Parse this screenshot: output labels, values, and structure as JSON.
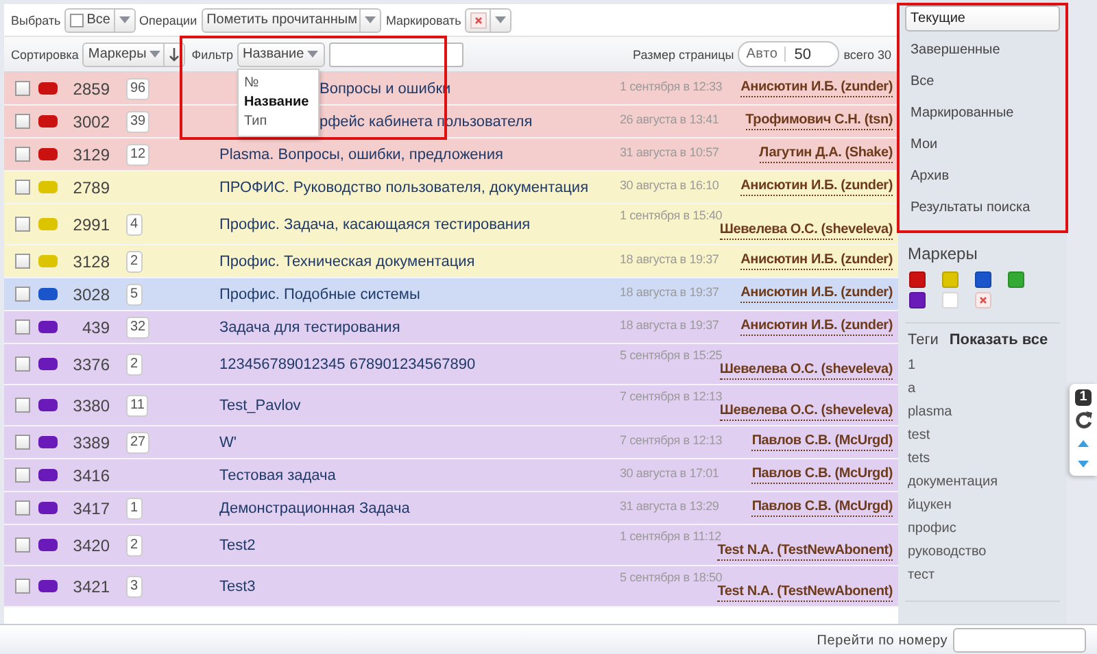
{
  "toolbar": {
    "select_label": "Выбрать",
    "select_all": {
      "label": "Все",
      "checked": false
    },
    "operations_label": "Операции",
    "operations_value": "Пометить прочитанным",
    "mark_label": "Маркировать"
  },
  "sortbar": {
    "sort_label": "Сортировка",
    "sort_value": "Маркеры",
    "filter_label": "Фильтр",
    "filter_field": "Название",
    "filter_options": [
      {
        "label": "№",
        "selected": false
      },
      {
        "label": "Название",
        "selected": true
      },
      {
        "label": "Тип",
        "selected": false
      }
    ],
    "page_size_label": "Размер страницы",
    "page_size_auto": "Авто",
    "page_size_value": "50",
    "total": "всего 30"
  },
  "rows": [
    {
      "checked": false,
      "color": "#cc1111",
      "number": "2859",
      "count": "96",
      "title": "Вопросы и ошибки",
      "date": "1 сентября в 12:33",
      "author": "Анисютин И.Б. (zunder)"
    },
    {
      "checked": false,
      "color": "#cc1111",
      "number": "3002",
      "count": "39",
      "title": "рфейс кабинета пользователя",
      "date": "26 августа в 13:41",
      "author": "Трофимович С.Н. (tsn)"
    },
    {
      "checked": false,
      "color": "#cc1111",
      "number": "3129",
      "count": "12",
      "title": "Plasma. Вопросы, ошибки, предложения",
      "date": "31 августа в 10:57",
      "author": "Лагутин Д.А. (Shake)"
    },
    {
      "checked": false,
      "color": "#ddc400",
      "number": "2789",
      "title": "ПРОФИС. Руководство пользователя, документация",
      "date": "30 августа в 16:10",
      "author": "Анисютин И.Б. (zunder)"
    },
    {
      "checked": false,
      "color": "#ddc400",
      "number": "2991",
      "count": "4",
      "title": "Профис. Задача, касающаяся тестирования",
      "date": "1 сентября в 15:40",
      "author": "Шевелева О.С. (sheveleva)"
    },
    {
      "checked": false,
      "color": "#ddc400",
      "number": "3128",
      "count": "2",
      "title": "Профис. Техническая документация",
      "date": "18 августа в 19:37",
      "author": "Анисютин И.Б. (zunder)"
    },
    {
      "checked": false,
      "color": "#1a55cc",
      "number": "3028",
      "count": "5",
      "title": "Профис. Подобные системы",
      "date": "18 августа в 19:37",
      "author": "Анисютин И.Б. (zunder)"
    },
    {
      "checked": false,
      "color": "#6a1ab8",
      "number": "439",
      "count": "32",
      "title": "Задача для тестирования",
      "date": "18 августа в 19:37",
      "author": "Анисютин И.Б. (zunder)"
    },
    {
      "checked": false,
      "color": "#6a1ab8",
      "number": "3376",
      "count": "2",
      "title": "123456789012345 678901234567890",
      "date": "5 сентября в 15:25",
      "author": "Шевелева О.С. (sheveleva)"
    },
    {
      "checked": false,
      "color": "#6a1ab8",
      "number": "3380",
      "count": "11",
      "title": "Test_Pavlov",
      "date": "7 сентября в 12:13",
      "author": "Шевелева О.С. (sheveleva)"
    },
    {
      "checked": false,
      "color": "#6a1ab8",
      "number": "3389",
      "count": "27",
      "title": "W'",
      "date": "7 сентября в 12:13",
      "author": "Павлов С.В. (McUrgd)"
    },
    {
      "checked": false,
      "color": "#6a1ab8",
      "number": "3416",
      "title": "Тестовая задача",
      "date": "30 августа в 17:01",
      "author": "Павлов С.В. (McUrgd)"
    },
    {
      "checked": false,
      "color": "#6a1ab8",
      "number": "3417",
      "count": "1",
      "title": "Демонстрационная Задача",
      "date": "31 августа в 13:29",
      "author": "Павлов С.В. (McUrgd)"
    },
    {
      "checked": false,
      "color": "#6a1ab8",
      "number": "3420",
      "count": "2",
      "title": "Test2",
      "date": "1 сентября в 11:12",
      "author": "Test N.A. (TestNewAbonent)"
    },
    {
      "checked": false,
      "color": "#6a1ab8",
      "number": "3421",
      "count": "3",
      "title": "Test3",
      "date": "5 сентября в 18:50",
      "author": "Test N.A. (TestNewAbonent)"
    }
  ],
  "sidebar": {
    "views": [
      {
        "label": "Текущие",
        "selected": true
      },
      {
        "label": "Завершенные",
        "selected": false
      },
      {
        "label": "Все",
        "selected": false
      },
      {
        "label": "Маркированные",
        "selected": false
      },
      {
        "label": "Мои",
        "selected": false
      },
      {
        "label": "Архив",
        "selected": false
      },
      {
        "label": "Результаты поиска",
        "selected": false
      }
    ],
    "markers_title": "Маркеры",
    "markers": [
      {
        "kind": "swatch",
        "color": "#cc1111"
      },
      {
        "kind": "swatch",
        "color": "#ddc400"
      },
      {
        "kind": "swatch",
        "color": "#1a55cc"
      },
      {
        "kind": "swatch",
        "color": "#33aa33"
      },
      {
        "kind": "swatch",
        "color": "#6a1ab8"
      },
      {
        "kind": "swatch",
        "color": "#ffffff"
      },
      {
        "kind": "clear"
      }
    ],
    "tags_title": "Теги",
    "show_all": "Показать все",
    "tags": [
      "1",
      "a",
      "plasma",
      "test",
      "tets",
      "документация",
      "йцукен",
      "профис",
      "руководство",
      "тест"
    ]
  },
  "side_tools": {
    "badge": "1"
  },
  "footer": {
    "goto_label": "Перейти по номеру"
  }
}
